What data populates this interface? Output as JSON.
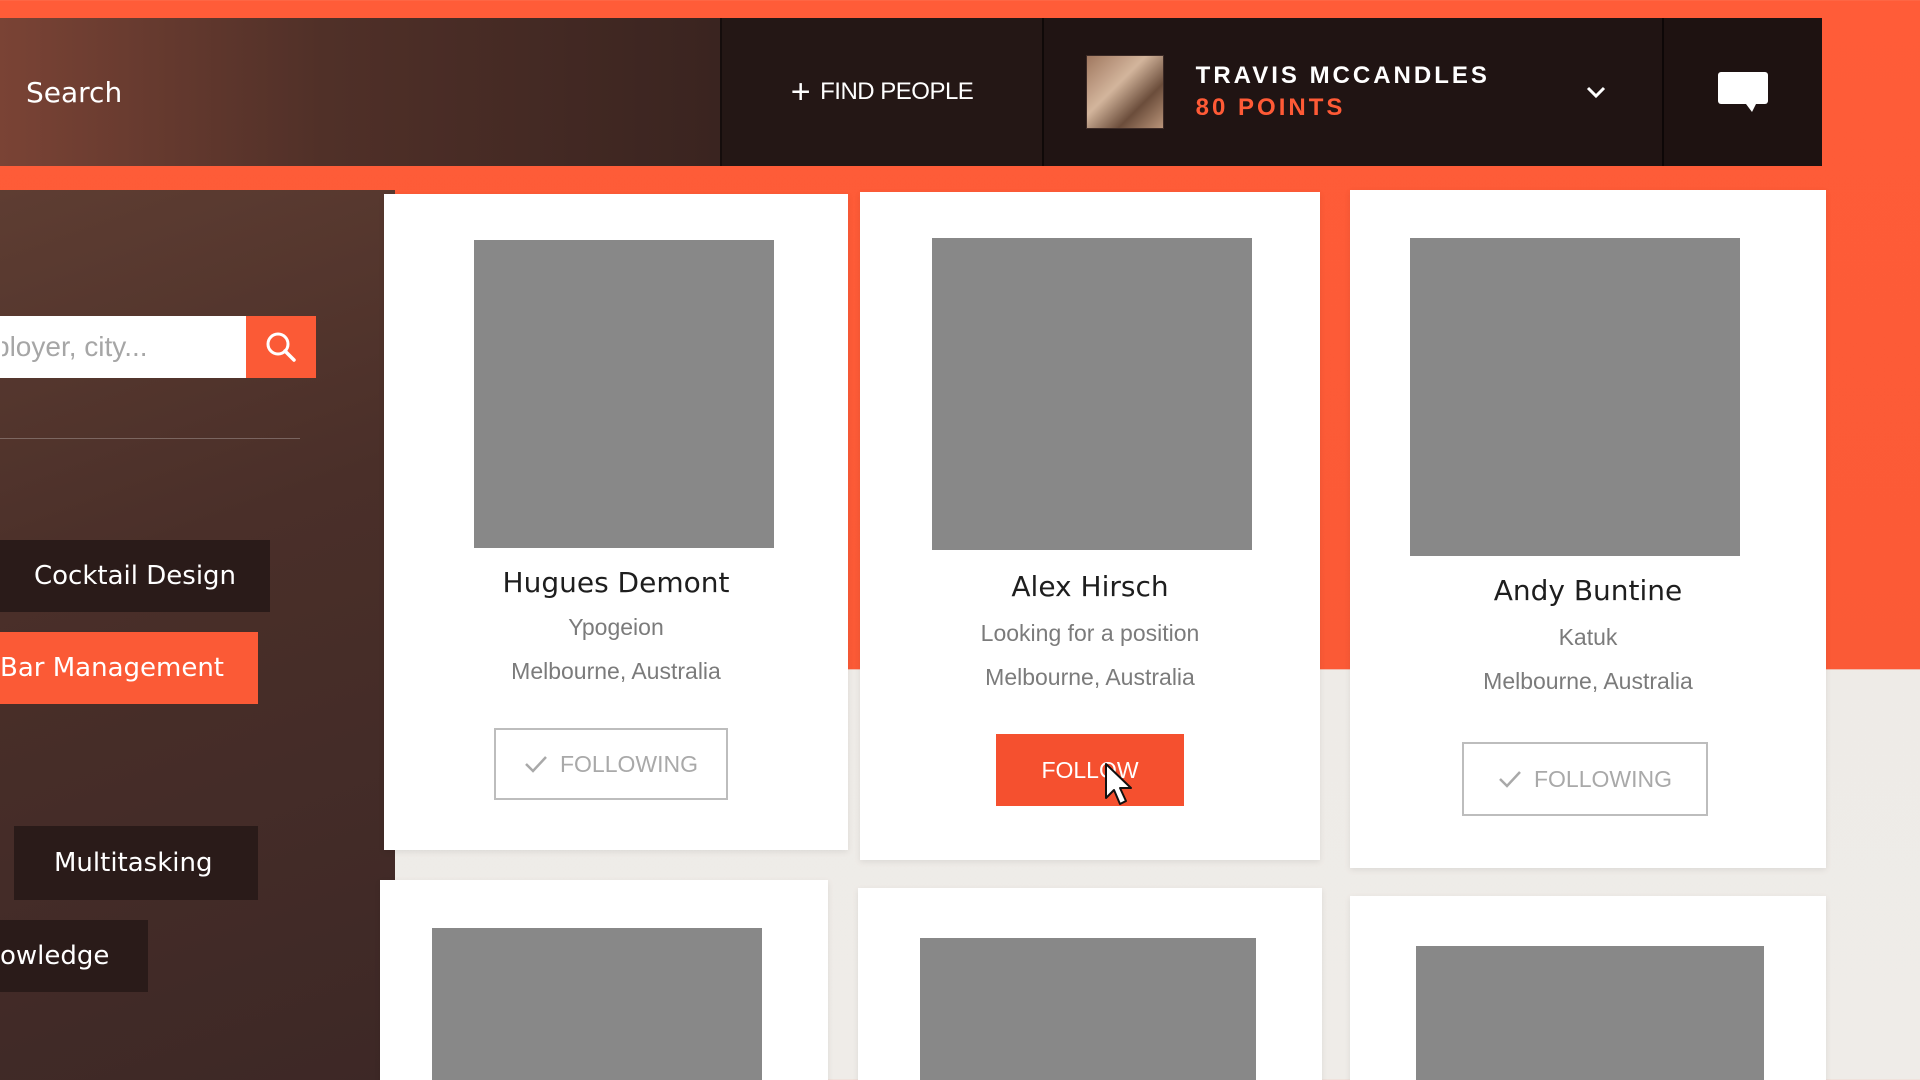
{
  "header": {
    "search_label": "Search",
    "find_people_label": "FIND PEOPLE",
    "user_name": "TRAVIS MCCANDLES",
    "user_points": "80 POINTS"
  },
  "sidebar": {
    "filter_placeholder": "ployer, city...",
    "tags": [
      {
        "label": "Cocktail Design"
      },
      {
        "label": "Bar Management"
      },
      {
        "label": "Multitasking"
      },
      {
        "label": "owledge"
      }
    ]
  },
  "people": [
    {
      "name": "Hugues Demont",
      "company": "Ypogeion",
      "location": "Melbourne, Australia",
      "action": "FOLLOWING"
    },
    {
      "name": "Alex Hirsch",
      "company": "Looking for a position",
      "location": "Melbourne, Australia",
      "action": "FOLLOW"
    },
    {
      "name": "Andy Buntine",
      "company": "Katuk",
      "location": "Melbourne, Australia",
      "action": "FOLLOWING"
    }
  ],
  "colors": {
    "accent": "#fb5a36",
    "dark": "#201413"
  },
  "icons": {
    "plus": "plus-icon",
    "chevron": "chevron-down-icon",
    "messages": "chat-bubble-icon",
    "search": "search-icon",
    "check": "check-icon",
    "cursor": "mouse-pointer-icon"
  }
}
